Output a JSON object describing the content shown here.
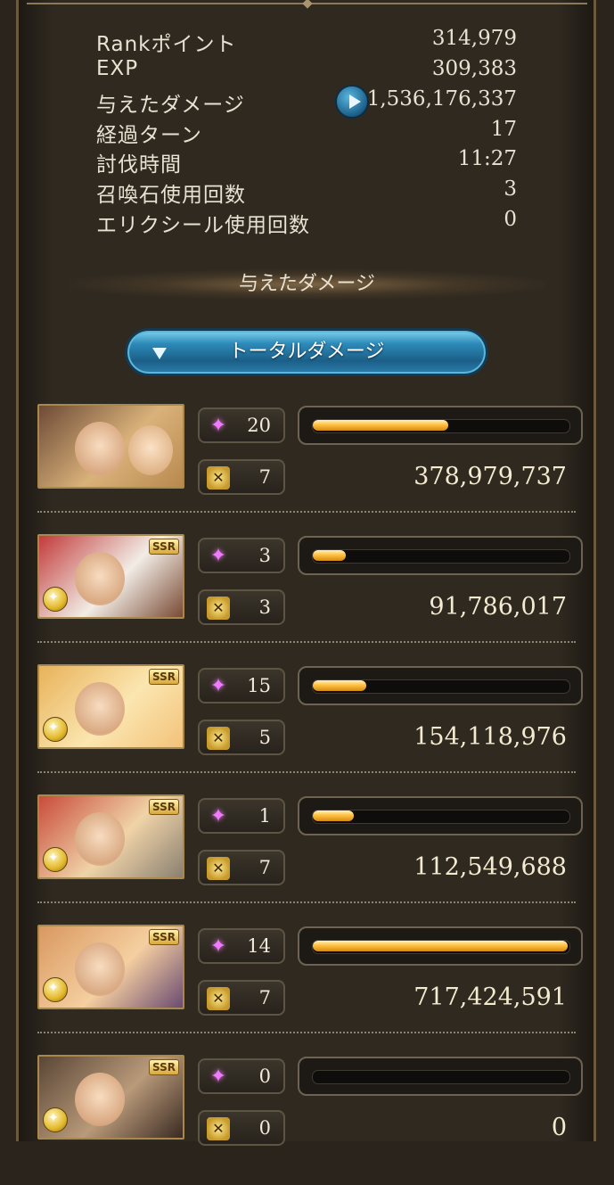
{
  "stats": [
    {
      "label": "Rankポイント",
      "value": "314,979"
    },
    {
      "label": "EXP",
      "value": "309,383"
    },
    {
      "label": "与えたダメージ",
      "value": "1,536,176,337"
    },
    {
      "label": "経過ターン",
      "value": "17"
    },
    {
      "label": "討伐時間",
      "value": "11:27"
    },
    {
      "label": "召喚石使用回数",
      "value": "3"
    },
    {
      "label": "エリクシール使用回数",
      "value": "0"
    }
  ],
  "section_title": "与えたダメージ",
  "toggle_label": "トータルダメージ",
  "characters": [
    {
      "ability_uses": "20",
      "ougi_count": "7",
      "damage": "378,979,737",
      "bar_fraction": 0.53,
      "rarity": "",
      "palette": [
        "#6e4a36",
        "#d9b27a",
        "#b8894f"
      ]
    },
    {
      "ability_uses": "3",
      "ougi_count": "3",
      "damage": "91,786,017",
      "bar_fraction": 0.13,
      "rarity": "SSR",
      "palette": [
        "#c23b3b",
        "#f2ede6",
        "#7a4a34"
      ]
    },
    {
      "ability_uses": "15",
      "ougi_count": "5",
      "damage": "154,118,976",
      "bar_fraction": 0.21,
      "rarity": "SSR",
      "palette": [
        "#e8b25a",
        "#fbe6b0",
        "#f3c27a"
      ]
    },
    {
      "ability_uses": "1",
      "ougi_count": "7",
      "damage": "112,549,688",
      "bar_fraction": 0.16,
      "rarity": "SSR",
      "palette": [
        "#c94b3a",
        "#f0d3a8",
        "#8a8070"
      ]
    },
    {
      "ability_uses": "14",
      "ougi_count": "7",
      "damage": "717,424,591",
      "bar_fraction": 1.0,
      "rarity": "SSR",
      "palette": [
        "#d99860",
        "#f5cfa0",
        "#6a4a72"
      ]
    },
    {
      "ability_uses": "0",
      "ougi_count": "0",
      "damage": "0",
      "bar_fraction": 0.0,
      "rarity": "SSR",
      "palette": [
        "#5a4636",
        "#b99a7a",
        "#3a2a22"
      ]
    }
  ]
}
